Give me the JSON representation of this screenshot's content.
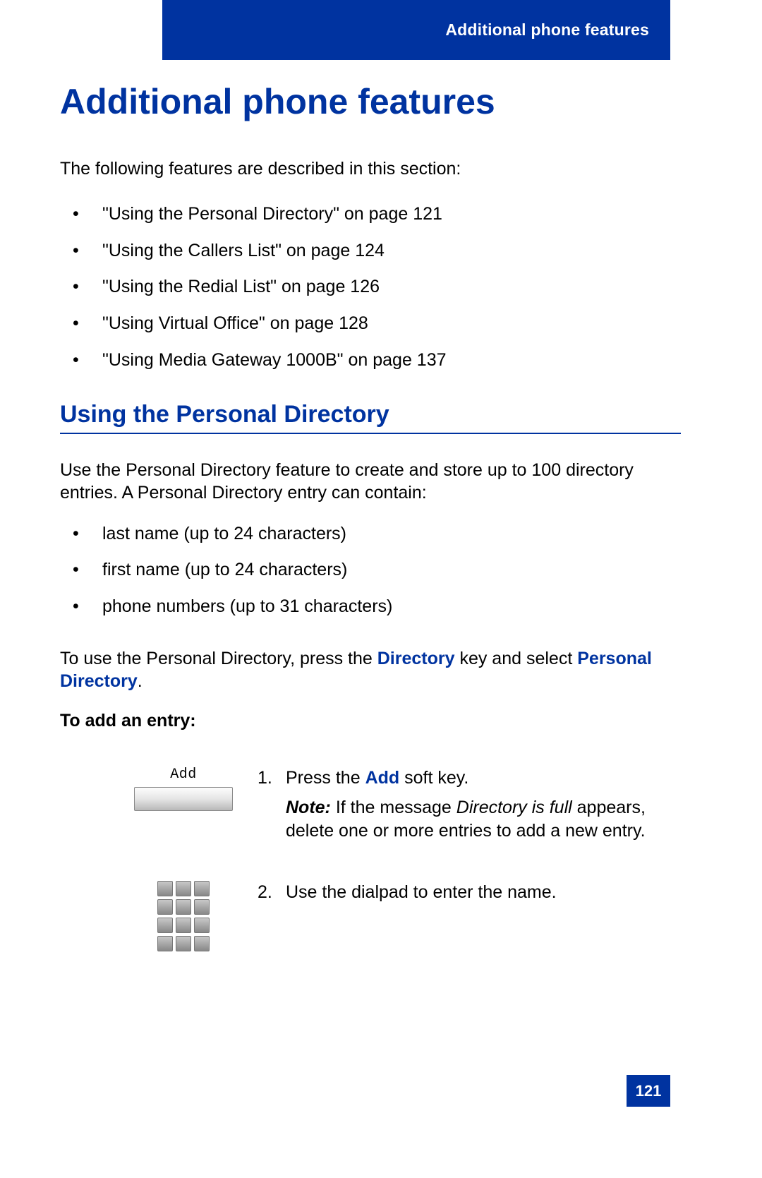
{
  "header": {
    "running_title": "Additional phone features"
  },
  "page": {
    "title": "Additional phone features",
    "intro": "The following features are described in this section:",
    "toc": [
      "\"Using the Personal Directory\" on page 121",
      "\"Using the Callers List\" on page 124",
      "\"Using the Redial List\" on page 126",
      "\"Using Virtual Office\" on page 128",
      "\"Using Media Gateway 1000B\" on page 137"
    ],
    "section_title": "Using the Personal Directory",
    "section_intro": "Use the Personal Directory feature to create and store up to 100 directory entries. A Personal Directory entry can contain:",
    "entry_fields": [
      "last name (up to 24 characters)",
      "first name (up to 24 characters)",
      "phone numbers (up to 31 characters)"
    ],
    "howto_prefix": "To use the Personal Directory, press the ",
    "howto_term1": "Directory",
    "howto_mid": " key and select ",
    "howto_term2": "Personal Directory",
    "howto_suffix": ".",
    "task_heading": "To add an entry:",
    "step1": {
      "num": "1.",
      "softkey_label": "Add",
      "text_prefix": "Press the ",
      "text_term": "Add",
      "text_suffix": " soft key.",
      "note_label": "Note:",
      "note_prefix": " If the message ",
      "note_msg": "Directory is full",
      "note_suffix": " appears, delete one or more entries to add a new entry."
    },
    "step2": {
      "num": "2.",
      "text": "Use the dialpad to enter the name."
    },
    "page_number": "121"
  }
}
